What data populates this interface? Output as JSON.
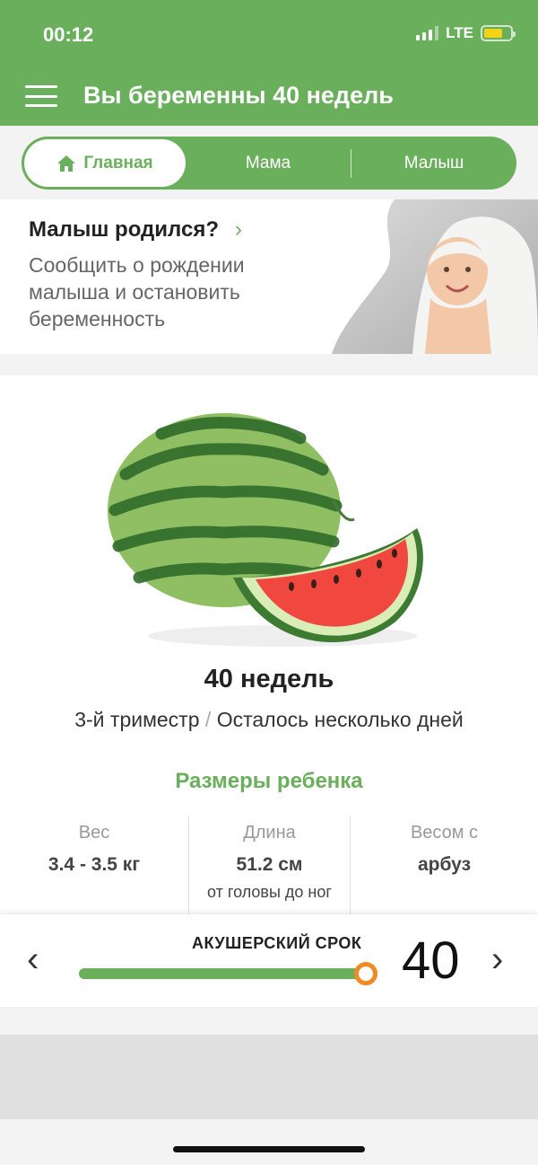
{
  "status_bar": {
    "time": "00:12",
    "network": "LTE"
  },
  "header": {
    "title": "Вы беременны 40 недель",
    "menu_icon": "hamburger-menu-icon"
  },
  "tabs": [
    {
      "label": "Главная",
      "icon": "home-icon",
      "active": true
    },
    {
      "label": "Мама",
      "active": false
    },
    {
      "label": "Малыш",
      "active": false
    }
  ],
  "born_banner": {
    "title": "Малыш родился?",
    "chevron": "›",
    "text": "Сообщить о рождении малыша и остановить беременность"
  },
  "week_info": {
    "title": "40 недель",
    "trimester": "3-й триместр",
    "separator": "/",
    "remaining": "Осталось несколько дней"
  },
  "sizes": {
    "title": "Размеры ребенка",
    "items": [
      {
        "label": "Вес",
        "value": "3.4 - 3.5 кг",
        "note": ""
      },
      {
        "label": "Длина",
        "value": "51.2 см",
        "note": "от головы до ног"
      },
      {
        "label": "Весом с",
        "value": "арбуз",
        "note": ""
      }
    ]
  },
  "week_selector": {
    "label": "АКУШЕРСКИЙ СРОК",
    "week": "40",
    "progress": 0.96,
    "prev": "‹",
    "next": "›"
  },
  "colors": {
    "brand_green": "#6aaf5b",
    "slider_thumb": "#f08a24"
  }
}
